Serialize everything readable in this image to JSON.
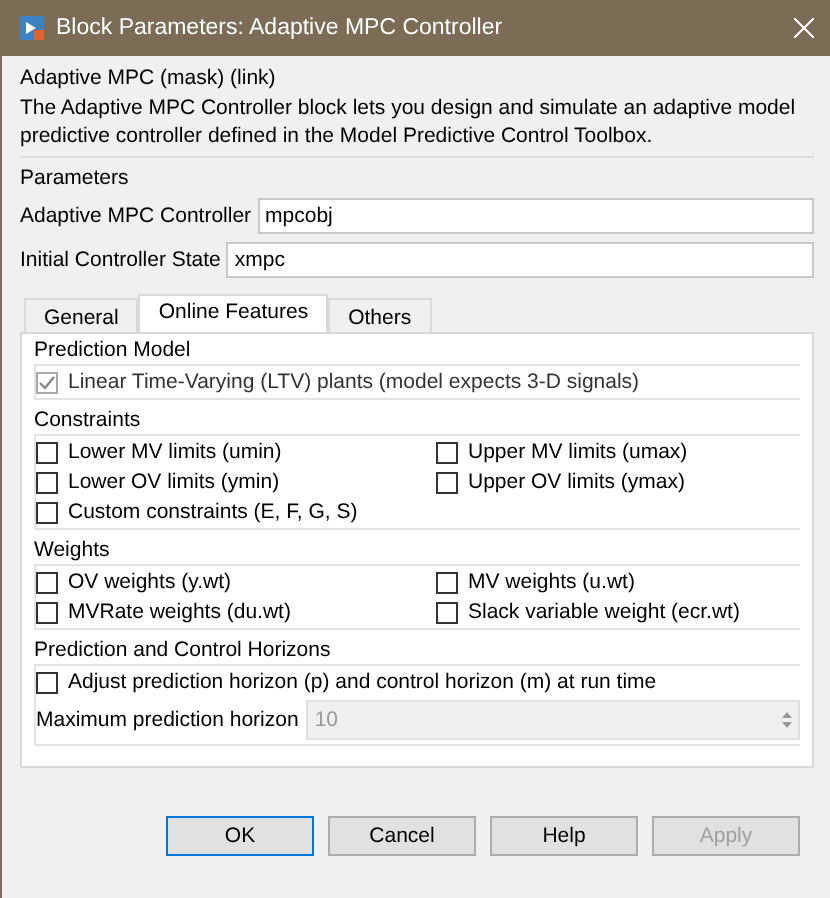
{
  "window": {
    "title": "Block Parameters: Adaptive MPC Controller"
  },
  "mask_header": "Adaptive MPC (mask) (link)",
  "description": "The Adaptive MPC Controller block lets you design and simulate an adaptive model predictive controller defined in the Model Predictive Control Toolbox.",
  "parameters": {
    "title": "Parameters",
    "fields": [
      {
        "label": "Adaptive MPC Controller",
        "value": "mpcobj"
      },
      {
        "label": "Initial Controller State",
        "value": "xmpc"
      }
    ]
  },
  "tabs": [
    {
      "label": "General",
      "selected": false
    },
    {
      "label": "Online Features",
      "selected": true
    },
    {
      "label": "Others",
      "selected": false
    }
  ],
  "groups": [
    {
      "title": "Prediction Model",
      "items": [
        {
          "kind": "checkbox",
          "label": "Linear Time-Varying (LTV) plants (model expects 3-D signals)",
          "checked": true,
          "disabled": true
        }
      ]
    },
    {
      "title": "Constraints",
      "items": [
        {
          "kind": "checkbox",
          "label": "Lower MV limits (umin)",
          "checked": false,
          "disabled": false
        },
        {
          "kind": "checkbox",
          "label": "Upper MV limits (umax)",
          "checked": false,
          "disabled": false
        },
        {
          "kind": "checkbox",
          "label": "Lower OV limits (ymin)",
          "checked": false,
          "disabled": false
        },
        {
          "kind": "checkbox",
          "label": "Upper OV limits (ymax)",
          "checked": false,
          "disabled": false
        },
        {
          "kind": "checkbox",
          "label": "Custom constraints (E, F, G, S)",
          "checked": false,
          "disabled": false
        }
      ]
    },
    {
      "title": "Weights",
      "items": [
        {
          "kind": "checkbox",
          "label": "OV weights (y.wt)",
          "checked": false,
          "disabled": false
        },
        {
          "kind": "checkbox",
          "label": "MV weights (u.wt)",
          "checked": false,
          "disabled": false
        },
        {
          "kind": "checkbox",
          "label": "MVRate weights (du.wt)",
          "checked": false,
          "disabled": false
        },
        {
          "kind": "checkbox",
          "label": "Slack variable weight (ecr.wt)",
          "checked": false,
          "disabled": false
        }
      ]
    },
    {
      "title": "Prediction and Control Horizons",
      "items": [
        {
          "kind": "checkbox",
          "label": "Adjust prediction horizon (p) and control horizon (m) at run time",
          "checked": false,
          "disabled": false
        },
        {
          "kind": "spinner",
          "label": "Maximum prediction horizon",
          "value": "10",
          "disabled": true
        }
      ]
    }
  ],
  "buttons": [
    {
      "label": "OK",
      "focused": true,
      "disabled": false
    },
    {
      "label": "Cancel",
      "focused": false,
      "disabled": false
    },
    {
      "label": "Help",
      "focused": false,
      "disabled": false
    },
    {
      "label": "Apply",
      "focused": false,
      "disabled": true
    }
  ]
}
